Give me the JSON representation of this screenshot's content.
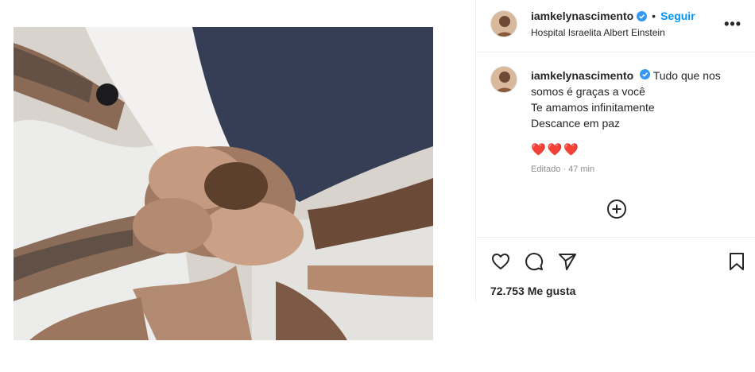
{
  "post": {
    "username": "iamkelynascimento",
    "follow_label": "Seguir",
    "separator": "•",
    "location": "Hospital Israelita Albert Einstein",
    "more_label": "•••",
    "caption_lines": [
      "Tudo que nos somos é graças a você",
      "Te amamos infinitamente",
      "Descance em paz"
    ],
    "hearts": "❤️❤️❤️",
    "edited": "Editado · 47 min",
    "likes": "72.753 Me gusta"
  },
  "icons": {
    "verified": "verified-badge-icon",
    "more": "more-options-icon",
    "add": "add-comment-circle-icon",
    "like": "heart-outline-icon",
    "comment": "comment-bubble-icon",
    "share": "paper-plane-icon",
    "save": "bookmark-icon"
  },
  "colors": {
    "link_blue": "#0095f6",
    "verified_blue": "#3897f0",
    "muted": "#8e8e8e",
    "heart_red": "#d6213a"
  }
}
